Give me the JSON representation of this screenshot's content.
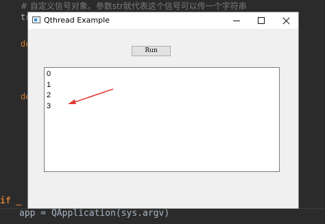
{
  "editor": {
    "comment_line": "#  自定义信号对象。参数str就代表这个信号可以传一个字符串",
    "frag_tr": "tr",
    "frag_de1": "de",
    "frag_de2": "de",
    "if_line": "if _",
    "bottom_line": "app = QApplication(sys.argv)"
  },
  "window": {
    "title": "Qthread Example",
    "run_label": "Run",
    "output_lines": [
      "0",
      "1",
      "2",
      "3"
    ]
  },
  "colors": {
    "arrow": "#e53935",
    "editor_bg": "#2b2b2b"
  },
  "icons": [
    "app-icon",
    "minimize-icon",
    "maximize-icon",
    "close-icon",
    "arrow-annotation"
  ]
}
